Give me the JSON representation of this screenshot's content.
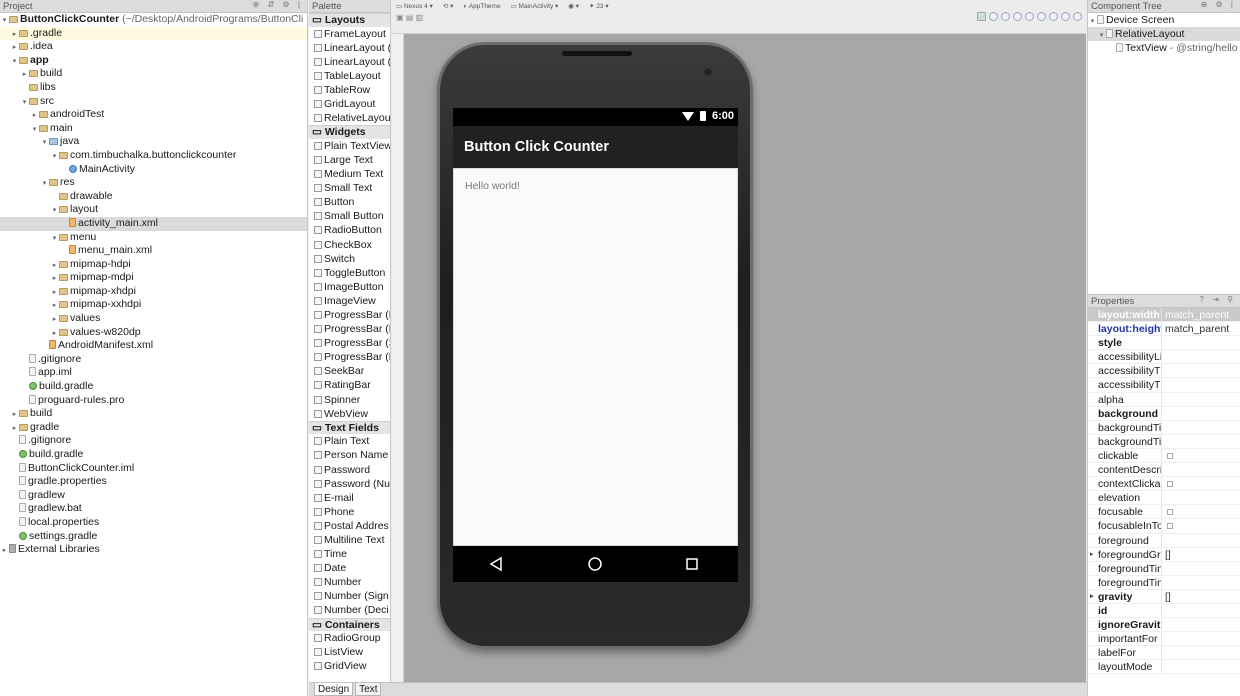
{
  "project_panel": {
    "title": "Project",
    "root_name": "ButtonClickCounter",
    "root_path": "(~/Desktop/AndroidPrograms/ButtonCli",
    "tree": [
      {
        "label": ".gradle",
        "indent": 1,
        "icon": "folder",
        "tw": "▸",
        "hl": true
      },
      {
        "label": ".idea",
        "indent": 1,
        "icon": "folder",
        "tw": "▸"
      },
      {
        "label": "app",
        "indent": 1,
        "icon": "folder",
        "tw": "▾",
        "bold": true
      },
      {
        "label": "build",
        "indent": 2,
        "icon": "folder",
        "tw": "▸"
      },
      {
        "label": "libs",
        "indent": 2,
        "icon": "folder",
        "tw": ""
      },
      {
        "label": "src",
        "indent": 2,
        "icon": "folder",
        "tw": "▾"
      },
      {
        "label": "androidTest",
        "indent": 3,
        "icon": "folder",
        "tw": "▸"
      },
      {
        "label": "main",
        "indent": 3,
        "icon": "folder",
        "tw": "▾"
      },
      {
        "label": "java",
        "indent": 4,
        "icon": "folder-blue",
        "tw": "▾"
      },
      {
        "label": "com.timbuchalka.buttonclickcounter",
        "indent": 5,
        "icon": "folder",
        "tw": "▾"
      },
      {
        "label": "MainActivity",
        "indent": 6,
        "icon": "class",
        "tw": ""
      },
      {
        "label": "res",
        "indent": 4,
        "icon": "folder",
        "tw": "▾"
      },
      {
        "label": "drawable",
        "indent": 5,
        "icon": "folder",
        "tw": ""
      },
      {
        "label": "layout",
        "indent": 5,
        "icon": "folder",
        "tw": "▾"
      },
      {
        "label": "activity_main.xml",
        "indent": 6,
        "icon": "xml",
        "tw": "",
        "sel": true
      },
      {
        "label": "menu",
        "indent": 5,
        "icon": "folder",
        "tw": "▾"
      },
      {
        "label": "menu_main.xml",
        "indent": 6,
        "icon": "xml",
        "tw": ""
      },
      {
        "label": "mipmap-hdpi",
        "indent": 5,
        "icon": "folder",
        "tw": "▸"
      },
      {
        "label": "mipmap-mdpi",
        "indent": 5,
        "icon": "folder",
        "tw": "▸"
      },
      {
        "label": "mipmap-xhdpi",
        "indent": 5,
        "icon": "folder",
        "tw": "▸"
      },
      {
        "label": "mipmap-xxhdpi",
        "indent": 5,
        "icon": "folder",
        "tw": "▸"
      },
      {
        "label": "values",
        "indent": 5,
        "icon": "folder",
        "tw": "▸"
      },
      {
        "label": "values-w820dp",
        "indent": 5,
        "icon": "folder",
        "tw": "▸"
      },
      {
        "label": "AndroidManifest.xml",
        "indent": 4,
        "icon": "xml",
        "tw": ""
      },
      {
        "label": ".gitignore",
        "indent": 2,
        "icon": "file",
        "tw": ""
      },
      {
        "label": "app.iml",
        "indent": 2,
        "icon": "file",
        "tw": ""
      },
      {
        "label": "build.gradle",
        "indent": 2,
        "icon": "gradle",
        "tw": ""
      },
      {
        "label": "proguard-rules.pro",
        "indent": 2,
        "icon": "file",
        "tw": ""
      },
      {
        "label": "build",
        "indent": 1,
        "icon": "folder",
        "tw": "▸"
      },
      {
        "label": "gradle",
        "indent": 1,
        "icon": "folder",
        "tw": "▸"
      },
      {
        "label": ".gitignore",
        "indent": 1,
        "icon": "file",
        "tw": ""
      },
      {
        "label": "build.gradle",
        "indent": 1,
        "icon": "gradle",
        "tw": ""
      },
      {
        "label": "ButtonClickCounter.iml",
        "indent": 1,
        "icon": "file",
        "tw": ""
      },
      {
        "label": "gradle.properties",
        "indent": 1,
        "icon": "file",
        "tw": ""
      },
      {
        "label": "gradlew",
        "indent": 1,
        "icon": "file",
        "tw": ""
      },
      {
        "label": "gradlew.bat",
        "indent": 1,
        "icon": "file",
        "tw": ""
      },
      {
        "label": "local.properties",
        "indent": 1,
        "icon": "file",
        "tw": ""
      },
      {
        "label": "settings.gradle",
        "indent": 1,
        "icon": "gradle",
        "tw": ""
      },
      {
        "label": "External Libraries",
        "indent": 0,
        "icon": "lib",
        "tw": "▸"
      }
    ]
  },
  "palette": {
    "title": "Palette",
    "groups": [
      {
        "name": "Layouts",
        "items": [
          "FrameLayout",
          "LinearLayout (",
          "LinearLayout (",
          "TableLayout",
          "TableRow",
          "GridLayout",
          "RelativeLayout"
        ]
      },
      {
        "name": "Widgets",
        "items": [
          "Plain TextView",
          "Large Text",
          "Medium Text",
          "Small Text",
          "Button",
          "Small Button",
          "RadioButton",
          "CheckBox",
          "Switch",
          "ToggleButton",
          "ImageButton",
          "ImageView",
          "ProgressBar (L",
          "ProgressBar (N",
          "ProgressBar (S",
          "ProgressBar (H",
          "SeekBar",
          "RatingBar",
          "Spinner",
          "WebView"
        ]
      },
      {
        "name": "Text Fields",
        "items": [
          "Plain Text",
          "Person Name",
          "Password",
          "Password (Nu",
          "E-mail",
          "Phone",
          "Postal Addres",
          "Multiline Text",
          "Time",
          "Date",
          "Number",
          "Number (Sign",
          "Number (Deci"
        ]
      },
      {
        "name": "Containers",
        "items": [
          "RadioGroup",
          "ListView",
          "GridView"
        ]
      }
    ]
  },
  "toolbar": {
    "device": "Nexus 4",
    "theme": "AppTheme",
    "activity": "MainActivity",
    "api": "23"
  },
  "preview": {
    "status_time": "6:00",
    "app_title": "Button Click Counter",
    "hello_text": "Hello world!"
  },
  "bottom_tabs": {
    "design": "Design",
    "text": "Text"
  },
  "component_tree": {
    "title": "Component Tree",
    "device_screen": "Device Screen",
    "relative_layout": "RelativeLayout",
    "textview": "TextView",
    "textview_value": "- @string/hello"
  },
  "properties": {
    "title": "Properties",
    "rows": [
      {
        "key": "layout:width",
        "value": "match_parent",
        "style": "blue",
        "sel": true
      },
      {
        "key": "layout:height",
        "value": "match_parent",
        "style": "blue"
      },
      {
        "key": "style",
        "value": "",
        "style": "b"
      },
      {
        "key": "accessibilityLi",
        "value": ""
      },
      {
        "key": "accessibilityT",
        "value": ""
      },
      {
        "key": "accessibilityT",
        "value": ""
      },
      {
        "key": "alpha",
        "value": ""
      },
      {
        "key": "background",
        "value": "",
        "style": "b"
      },
      {
        "key": "backgroundTi",
        "value": ""
      },
      {
        "key": "backgroundTi",
        "value": ""
      },
      {
        "key": "clickable",
        "value": "",
        "chk": true
      },
      {
        "key": "contentDescri",
        "value": ""
      },
      {
        "key": "contextClicka",
        "value": "",
        "chk": true
      },
      {
        "key": "elevation",
        "value": ""
      },
      {
        "key": "focusable",
        "value": "",
        "chk": true
      },
      {
        "key": "focusableInTo",
        "value": "",
        "chk": true
      },
      {
        "key": "foreground",
        "value": ""
      },
      {
        "key": "foregroundGr",
        "value": "[]",
        "exp": true
      },
      {
        "key": "foregroundTin",
        "value": ""
      },
      {
        "key": "foregroundTin",
        "value": ""
      },
      {
        "key": "gravity",
        "value": "[]",
        "style": "b",
        "exp": true
      },
      {
        "key": "id",
        "value": "",
        "style": "b"
      },
      {
        "key": "ignoreGravit",
        "value": "",
        "style": "b"
      },
      {
        "key": "importantFor",
        "value": ""
      },
      {
        "key": "labelFor",
        "value": ""
      },
      {
        "key": "layoutMode",
        "value": ""
      }
    ]
  }
}
